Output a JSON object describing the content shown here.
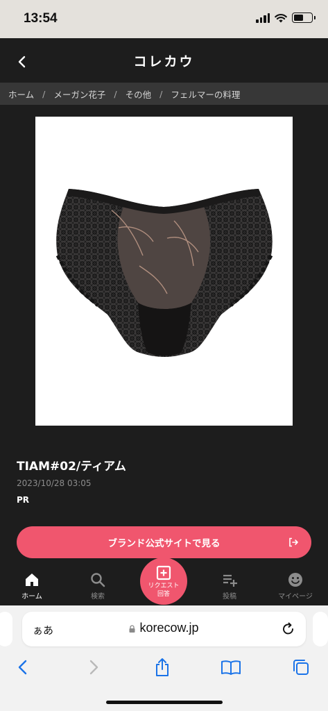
{
  "status_bar": {
    "time": "13:54",
    "icons": [
      "signal-icon",
      "wifi-icon",
      "battery-icon"
    ],
    "battery_level": 0.55
  },
  "header": {
    "back_icon": "chevron-left-icon",
    "title": "コレカウ"
  },
  "breadcrumb": [
    {
      "label": "ホーム"
    },
    {
      "label": "メーガン花子"
    },
    {
      "label": "その他"
    },
    {
      "label": "フェルマーの料理"
    }
  ],
  "breadcrumb_separator": "/",
  "product": {
    "image_alt": "black lace panties product photo",
    "title": "TIAM#02/ティアム",
    "date": "2023/10/28 03:05",
    "pr_label": "PR",
    "brand_button_label": "ブランド公式サイトで見る",
    "brand_button_icon": "external-link-icon"
  },
  "bottom_nav": {
    "items": [
      {
        "label": "ホーム",
        "icon": "home-icon",
        "active": true
      },
      {
        "label": "検索",
        "icon": "search-icon",
        "active": false
      },
      {
        "label": "投稿",
        "icon": "playlist-add-icon",
        "active": false
      },
      {
        "label": "マイページ",
        "icon": "smile-icon",
        "active": false
      }
    ],
    "request": {
      "label": "リクエスト",
      "sub": "回答",
      "icon": "plus-square-icon"
    }
  },
  "browser": {
    "aa_label": "ぁあ",
    "url": "korecow.jp",
    "toolbar_icons": [
      "back-icon",
      "forward-icon",
      "share-icon",
      "bookmarks-icon",
      "tabs-icon"
    ]
  },
  "colors": {
    "accent": "#f0566e",
    "background": "#1d1d1d",
    "breadcrumb_bg": "#373737",
    "status_bar_bg": "#e4e1dc"
  }
}
